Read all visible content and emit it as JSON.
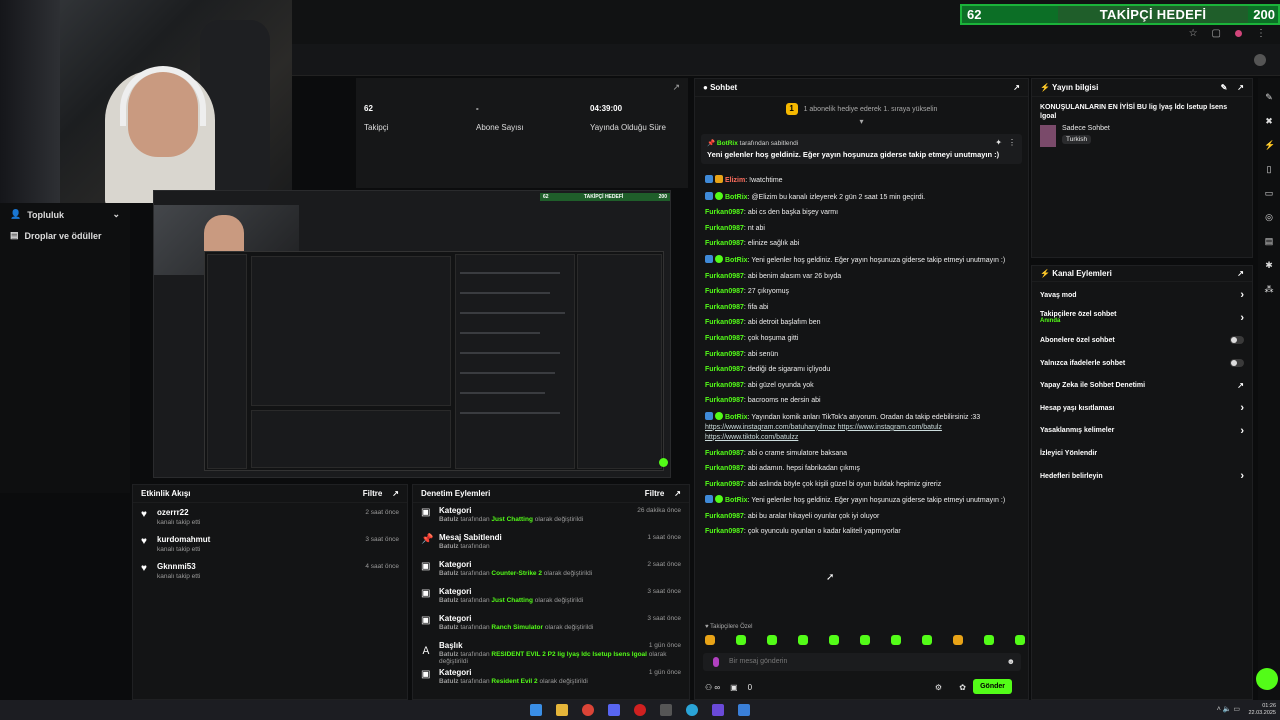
{
  "goal": {
    "current": "62",
    "label": "TAKİPÇİ HEDEFİ",
    "target": "200"
  },
  "sidebar": {
    "items": [
      {
        "label": "Topluluk",
        "icon": "people-icon"
      },
      {
        "label": "Droplar ve ödüller",
        "icon": "gift-icon"
      }
    ]
  },
  "stats": [
    {
      "value": "62",
      "label": "Takipçi"
    },
    {
      "value": "-",
      "label": "Abone Sayısı"
    },
    {
      "value": "04:39:00",
      "label": "Yayında Olduğu Süre"
    }
  ],
  "nested_goal": {
    "current": "62",
    "label": "TAKİPÇİ HEDEFİ",
    "target": "200"
  },
  "activity": {
    "title": "Etkinlik Akışı",
    "filter": "Filtre",
    "items": [
      {
        "user": "ozerrr22",
        "sub": "kanalı takip etti",
        "time": "2 saat önce"
      },
      {
        "user": "kurdomahmut",
        "sub": "kanalı takip etti",
        "time": "3 saat önce"
      },
      {
        "user": "Gknnmi53",
        "sub": "kanalı takip etti",
        "time": "4 saat önce"
      }
    ]
  },
  "moderation": {
    "title": "Denetim Eylemleri",
    "filter": "Filtre",
    "items": [
      {
        "title": "Kategori",
        "by": "Batulz",
        "mid": "tarafından",
        "value": "Just Chatting",
        "tail": "olarak değiştirildi",
        "time": "26 dakika önce"
      },
      {
        "title": "Mesaj Sabitlendi",
        "by": "Batulz",
        "mid": "tarafından",
        "value": "",
        "tail": "",
        "time": "1 saat önce"
      },
      {
        "title": "Kategori",
        "by": "Batulz",
        "mid": "tarafından",
        "value": "Counter-Strike 2",
        "tail": "olarak değiştirildi",
        "time": "2 saat önce"
      },
      {
        "title": "Kategori",
        "by": "Batulz",
        "mid": "tarafından",
        "value": "Just Chatting",
        "tail": "olarak değiştirildi",
        "time": "3 saat önce"
      },
      {
        "title": "Kategori",
        "by": "Batulz",
        "mid": "tarafından",
        "value": "Ranch Simulator",
        "tail": "olarak değiştirildi",
        "time": "3 saat önce"
      },
      {
        "title": "Başlık",
        "by": "Batulz",
        "mid": "tarafından",
        "value": "RESIDENT EVIL 2 P2 lig lyaş ldc lsetup lsens lgoal",
        "tail": "olarak değiştirildi",
        "time": "1 gün önce"
      },
      {
        "title": "Kategori",
        "by": "Batulz",
        "mid": "tarafından",
        "value": "Resident Evil 2",
        "tail": "olarak değiştirildi",
        "time": "1 gün önce"
      }
    ]
  },
  "chat": {
    "title": "Sohbet",
    "gift_banner": "1 abonelik hediye ederek 1. sıraya yükselin",
    "gift_num": "1",
    "pinned": {
      "by": "BotRix",
      "by_suffix": "tarafından sabitlendi",
      "text": "Yeni gelenler hoş geldiniz. Eğer yayın hoşunuza giderse takip etmeyi unutmayın :)"
    },
    "messages": [
      {
        "user": "Elizim",
        "text": "!watchtime",
        "color": "o"
      },
      {
        "user": "BotRix",
        "text": "@Elizim bu kanalı izleyerek 2 gün 2 saat 15 min geçirdi."
      },
      {
        "user": "Furkan0987",
        "text": "abi cs den başka bişey varmı"
      },
      {
        "user": "Furkan0987",
        "text": "nt abi"
      },
      {
        "user": "Furkan0987",
        "text": "elinize sağlık abi"
      },
      {
        "user": "BotRix",
        "text": "Yeni gelenler hoş geldiniz. Eğer yayın hoşunuza giderse takip etmeyi unutmayın :)"
      },
      {
        "user": "Furkan0987",
        "text": "abi benim alasım var 26 bıyda"
      },
      {
        "user": "Furkan0987",
        "text": "27 çıkıyomuş"
      },
      {
        "user": "Furkan0987",
        "text": "fifa abi"
      },
      {
        "user": "Furkan0987",
        "text": "abi detroit başlafım ben"
      },
      {
        "user": "Furkan0987",
        "text": "çok hoşuma gitti"
      },
      {
        "user": "Furkan0987",
        "text": "abi senün"
      },
      {
        "user": "Furkan0987",
        "text": "dediği de sigaramı içliyodu"
      },
      {
        "user": "Furkan0987",
        "text": "abi güzel oyunda yok"
      },
      {
        "user": "Furkan0987",
        "text": "bacrooms ne dersin abi"
      },
      {
        "user": "BotRix",
        "text": "Yayından komik anları TikTok'a atıyorum. Oradan da takip edebilirsiniz :33",
        "links": "https://www.instagram.com/batuhanyilmaz https://www.instagram.com/batulz https://www.tiktok.com/batulzz"
      },
      {
        "user": "Furkan0987",
        "text": "abi o crame simulatore baksana"
      },
      {
        "user": "Furkan0987",
        "text": "abi adamın. hepsi fabrikadan çıkmış"
      },
      {
        "user": "Furkan0987",
        "text": "abi aslında böyle çok kişili güzel bi oyun buldak hepimiz gireriz"
      },
      {
        "user": "BotRix",
        "text": "Yeni gelenler hoş geldiniz. Eğer yayın hoşunuza giderse takip etmeyi unutmayın :)"
      },
      {
        "user": "Furkan0987",
        "text": "abi bu aralar hikayeli oyunlar çok iyi oluyor"
      },
      {
        "user": "Furkan0987",
        "text": "çok oyunculu oyunları o kadar kaliteli yapmıyorlar"
      }
    ],
    "followers_only": "Takipçilere Özel",
    "placeholder": "Bir mesaj gönderin",
    "points": "0",
    "send": "Gönder"
  },
  "stream": {
    "title": "Yayın bilgisi",
    "stream_title": "KONUŞULANLARIN EN İYİSİ BU lig lyaş ldc lsetup lsens lgoal",
    "category": "Sadece Sohbet",
    "language": "Turkish"
  },
  "channel_actions": {
    "title": "Kanal Eylemleri",
    "rows": [
      {
        "label": "Yavaş mod",
        "control": "chevron"
      },
      {
        "label": "Takipçilere özel sohbet",
        "sub": "Anında",
        "control": "chevron"
      },
      {
        "label": "Abonelere özel sohbet",
        "control": "toggle"
      },
      {
        "label": "Yalnızca ifadelerle sohbet",
        "control": "toggle"
      },
      {
        "label": "Yapay Zeka ile Sohbet Denetimi",
        "control": "external"
      },
      {
        "label": "Hesap yaşı kısıtlaması",
        "control": "chevron"
      },
      {
        "label": "Yasaklanmış kelimeler",
        "control": "chevron"
      },
      {
        "label": "İzleyici Yönlendir",
        "control": "none"
      },
      {
        "label": "Hedefleri belirleyin",
        "control": "chevron"
      }
    ]
  },
  "taskbar": {
    "time": "01:26",
    "date": "22.03.2025"
  },
  "colors": {
    "accent": "#53fc18",
    "bg": "#0b0c0d",
    "panel": "#131415"
  }
}
